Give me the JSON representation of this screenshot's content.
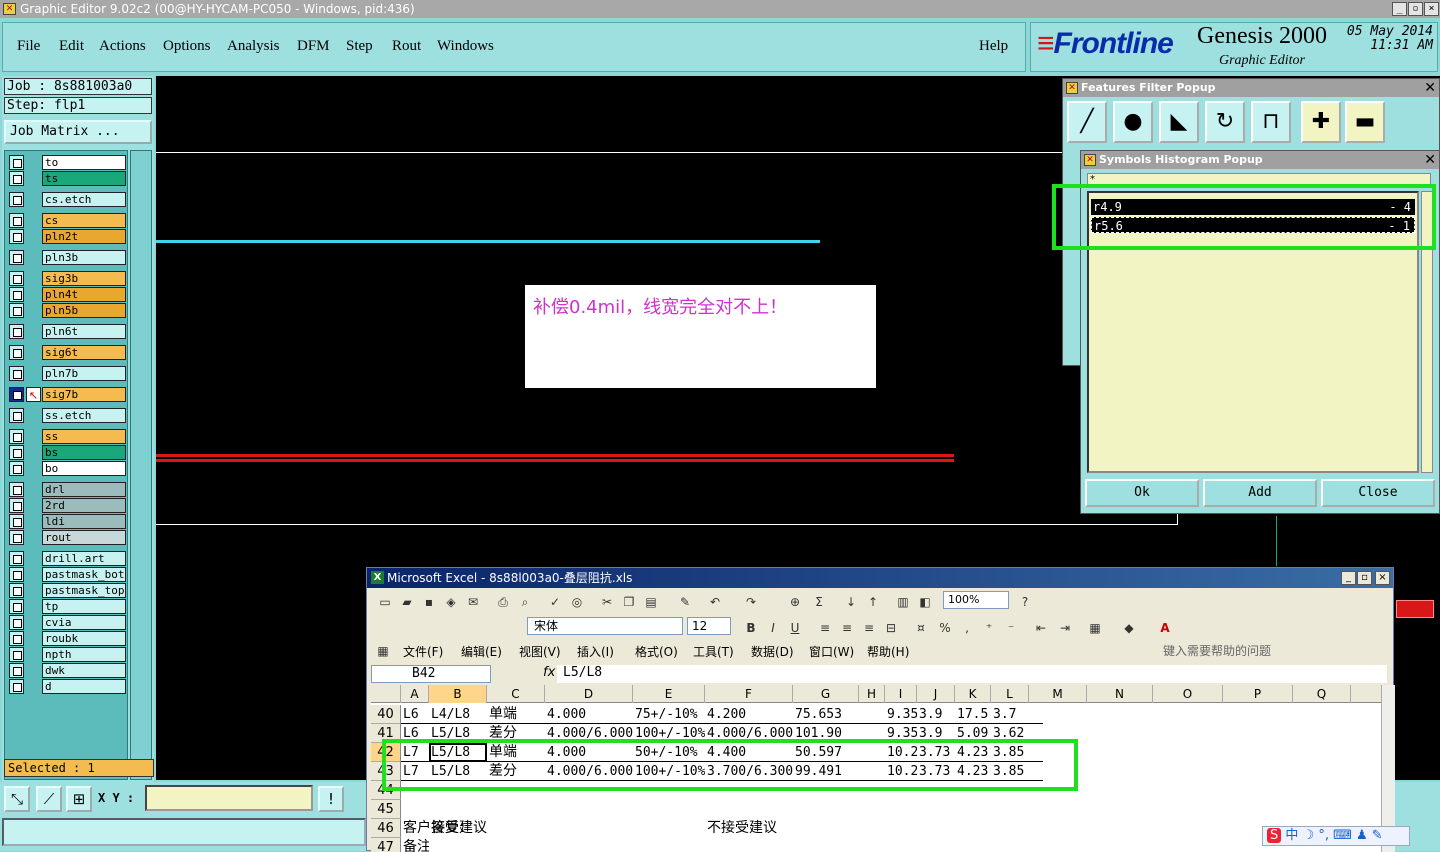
{
  "window": {
    "title": "Graphic Editor 9.02c2 (00@HY-HYCAM-PC050 - Windows, pid:436)"
  },
  "menu": {
    "items": [
      "File",
      "Edit",
      "Actions",
      "Options",
      "Analysis",
      "DFM",
      "Step",
      "Rout",
      "Windows"
    ],
    "help": "Help"
  },
  "brand": {
    "logo_main": "Frontline",
    "product": "Genesis 2000",
    "subtitle": "Graphic Editor",
    "date": "05 May 2014",
    "time": "11:31 AM"
  },
  "job": {
    "job_line": "Job : 8s881003a0",
    "step_line": "Step: flp1",
    "matrix_label": "Job Matrix ..."
  },
  "layers": [
    {
      "name": "to",
      "color": "#ffffff"
    },
    {
      "name": "ts",
      "color": "#1aa87a"
    },
    {
      "name": "cs.etch",
      "color": "#c6f2f2"
    },
    {
      "name": "cs",
      "color": "#f4bc50"
    },
    {
      "name": "pln2t",
      "color": "#e8a830"
    },
    {
      "name": "pln3b",
      "color": "#c6f2f2"
    },
    {
      "name": "sig3b",
      "color": "#f4bc50"
    },
    {
      "name": "pln4t",
      "color": "#e8a830"
    },
    {
      "name": "pln5b",
      "color": "#e8a830"
    },
    {
      "name": "pln6t",
      "color": "#c6f2f2"
    },
    {
      "name": "sig6t",
      "color": "#f4bc50"
    },
    {
      "name": "pln7b",
      "color": "#c6f2f2"
    },
    {
      "name": "sig7b",
      "color": "#f4bc50"
    },
    {
      "name": "ss.etch",
      "color": "#c6f2f2"
    },
    {
      "name": "ss",
      "color": "#f4bc50"
    },
    {
      "name": "bs",
      "color": "#1aa87a"
    },
    {
      "name": "bo",
      "color": "#ffffff"
    },
    {
      "name": "drl",
      "color": "#9cbcbc"
    },
    {
      "name": "2rd",
      "color": "#9cbcbc"
    },
    {
      "name": "ldi",
      "color": "#9cbcbc"
    },
    {
      "name": "rout",
      "color": "#c8d8d8"
    },
    {
      "name": "drill.art",
      "color": "#c6f2f2"
    },
    {
      "name": "pastmask_bot",
      "color": "#c6f2f2"
    },
    {
      "name": "pastmask_top",
      "color": "#c6f2f2"
    },
    {
      "name": "tp",
      "color": "#c6f2f2"
    },
    {
      "name": "cvia",
      "color": "#c6f2f2"
    },
    {
      "name": "roubk",
      "color": "#c6f2f2"
    },
    {
      "name": "npth",
      "color": "#c6f2f2"
    },
    {
      "name": "dwk",
      "color": "#c6f2f2"
    },
    {
      "name": "d",
      "color": "#c6f2f2"
    }
  ],
  "status": {
    "selected": "Selected : 1",
    "xy_label": "X Y :"
  },
  "features_popup": {
    "title": "Features Filter Popup"
  },
  "symbols_popup": {
    "title": "Symbols Histogram Popup",
    "filter": "*",
    "rows": [
      {
        "symbol": "r4.9",
        "count": "- 4"
      },
      {
        "symbol": "r5.6",
        "count": "- 1"
      }
    ],
    "buttons": [
      "Ok",
      "Add",
      "Close"
    ]
  },
  "note": {
    "text": "补偿0.4mil，线宽完全对不上！"
  },
  "excel": {
    "title": "Microsoft Excel - 8s88l003a0-叠层阻抗.xls",
    "font": "宋体",
    "size": "12",
    "zoom": "100%",
    "menus": [
      "文件(F)",
      "编辑(E)",
      "视图(V)",
      "插入(I)",
      "格式(O)",
      "工具(T)",
      "数据(D)",
      "窗口(W)",
      "帮助(H)"
    ],
    "help_placeholder": "键入需要帮助的问题",
    "name_box": "B42",
    "formula": "L5/L8",
    "columns": [
      "A",
      "B",
      "C",
      "D",
      "E",
      "F",
      "G",
      "H",
      "I",
      "J",
      "K",
      "L",
      "M",
      "N",
      "O",
      "P",
      "Q"
    ],
    "rows": [
      {
        "num": "40",
        "cells": [
          "L6",
          "L4/L8",
          "单端",
          "4.000",
          "75+/-10%",
          "4.200",
          "75.653",
          "",
          "9.35",
          "3.9",
          "17.5",
          "3.7"
        ]
      },
      {
        "num": "41",
        "cells": [
          "L6",
          "L5/L8",
          "差分",
          "4.000/6.000",
          "100+/-10%",
          "4.000/6.000",
          "101.90",
          "",
          "9.35",
          "3.9",
          "5.09",
          "3.62"
        ]
      },
      {
        "num": "42",
        "cells": [
          "L7",
          "L5/L8",
          "单端",
          "4.000",
          "50+/-10%",
          "4.400",
          "50.597",
          "",
          "10.2",
          "3.73",
          "4.23",
          "3.85"
        ]
      },
      {
        "num": "43",
        "cells": [
          "L7",
          "L5/L8",
          "差分",
          "4.000/6.000",
          "100+/-10%",
          "3.700/6.300",
          "99.491",
          "",
          "10.2",
          "3.73",
          "4.23",
          "3.85"
        ]
      },
      {
        "num": "44",
        "cells": [
          "",
          "",
          "",
          "",
          "",
          "",
          "",
          "",
          "",
          "",
          "",
          ""
        ]
      },
      {
        "num": "45",
        "cells": [
          "",
          "",
          "",
          "",
          "",
          "",
          "",
          "",
          "",
          "",
          "",
          ""
        ]
      },
      {
        "num": "46",
        "cells": [
          "客户答复：",
          "接受建议",
          "",
          "",
          "",
          "不接受建议",
          "",
          "",
          "",
          "",
          "",
          ""
        ]
      },
      {
        "num": "47",
        "cells": [
          "备注",
          "",
          "",
          "",
          "",
          "",
          "",
          "",
          "",
          "",
          "",
          ""
        ]
      }
    ]
  },
  "ime": {
    "text": "中"
  },
  "colors": {
    "selection_box": "#1ee01e",
    "note_text": "#cc33cc",
    "canvas": "#000000"
  }
}
